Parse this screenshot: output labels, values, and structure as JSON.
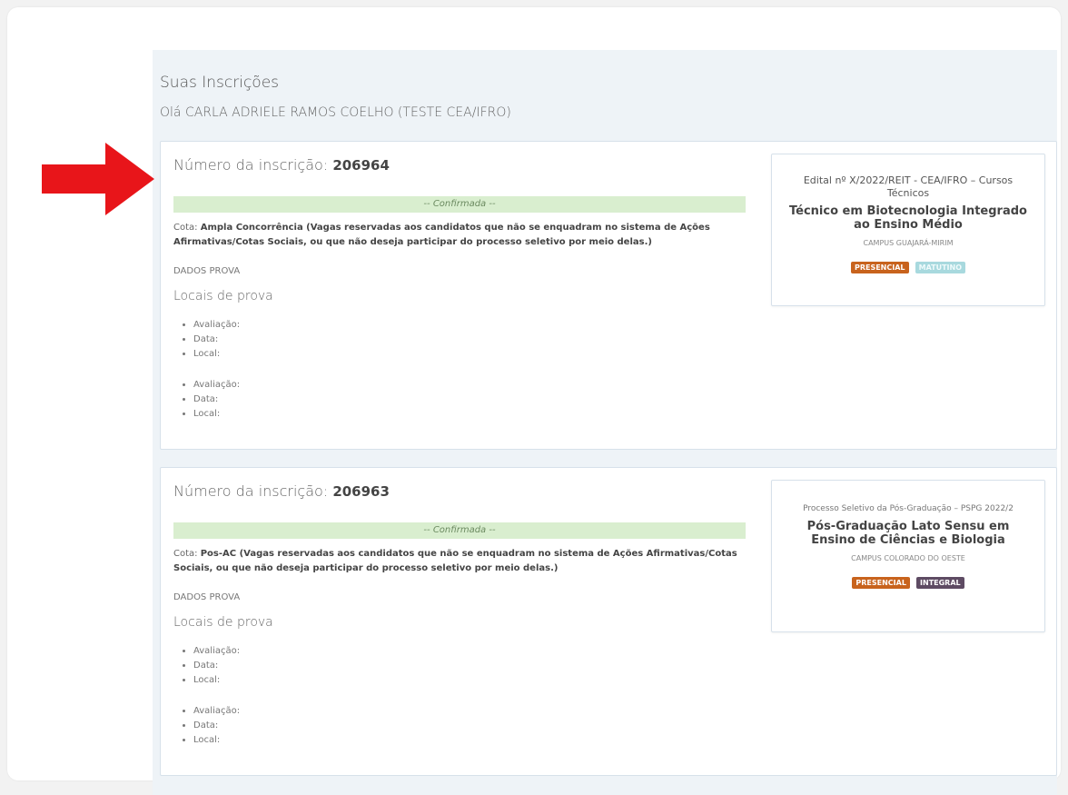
{
  "page": {
    "title": "Suas Inscrições",
    "greeting": "Olá CARLA ADRIELE RAMOS COELHO (TESTE CEA/IFRO)"
  },
  "annotation": {
    "arrow_color": "#e8151a",
    "icon": "arrow-right-icon"
  },
  "inscriptions": [
    {
      "label": "Número da inscrição:",
      "number": "206964",
      "status": "-- Confirmada --",
      "cota_label": "Cota:",
      "cota_value": "Ampla Concorrência (Vagas reservadas aos candidatos que não se enquadram no sistema de Ações Afirmativas/Cotas Sociais, ou que não deseja participar do processo seletivo por meio delas.)",
      "dados_prova": "DADOS PROVA",
      "locais_title": "Locais de prova",
      "groups": [
        [
          "Avaliação:",
          "Data:",
          "Local:"
        ],
        [
          "Avaliação:",
          "Data:",
          "Local:"
        ]
      ],
      "edital": {
        "name": "Edital nº X/2022/REIT - CEA/IFRO – Cursos Técnicos",
        "course": "Técnico em Biotecnologia Integrado ao Ensino Médio",
        "campus": "CAMPUS GUAJARÁ-MIRIM",
        "badges": [
          "PRESENCIAL",
          "MATUTINO"
        ]
      }
    },
    {
      "label": "Número da inscrição:",
      "number": "206963",
      "status": "-- Confirmada --",
      "cota_label": "Cota:",
      "cota_value": "Pos-AC (Vagas reservadas aos candidatos que não se enquadram no sistema de Ações Afirmativas/Cotas Sociais, ou que não deseja participar do processo seletivo por meio delas.)",
      "dados_prova": "DADOS PROVA",
      "locais_title": "Locais de prova",
      "groups": [
        [
          "Avaliação:",
          "Data:",
          "Local:"
        ],
        [
          "Avaliação:",
          "Data:",
          "Local:"
        ]
      ],
      "edital": {
        "name": "Processo Seletivo da Pós-Graduação – PSPG 2022/2",
        "course": "Pós-Graduação Lato Sensu em Ensino de Ciências e Biologia",
        "campus": "CAMPUS COLORADO DO OESTE",
        "badges": [
          "PRESENCIAL",
          "INTEGRAL"
        ]
      }
    }
  ]
}
